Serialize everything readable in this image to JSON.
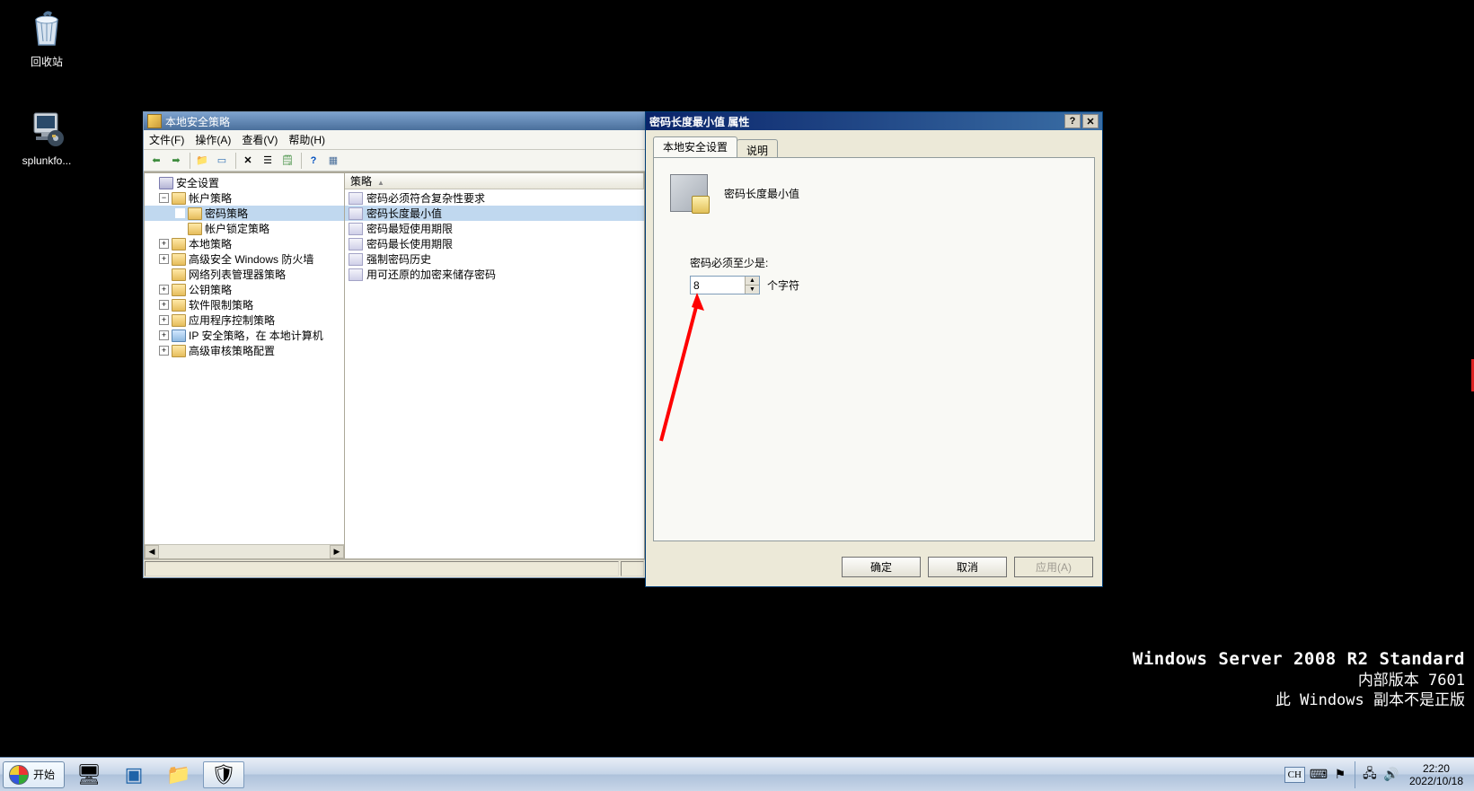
{
  "desktop": {
    "recycle_bin": "回收站",
    "splunk": "splunkfo..."
  },
  "mmc": {
    "title": "本地安全策略",
    "menu": {
      "file": "文件(F)",
      "action": "操作(A)",
      "view": "查看(V)",
      "help": "帮助(H)"
    },
    "tree": {
      "root": "安全设置",
      "account_policies": "帐户策略",
      "password_policy": "密码策略",
      "lockout_policy": "帐户锁定策略",
      "local_policies": "本地策略",
      "wfas": "高级安全 Windows 防火墙",
      "nlm": "网络列表管理器策略",
      "pubkey": "公钥策略",
      "srp": "软件限制策略",
      "appctrl": "应用程序控制策略",
      "ipsec": "IP 安全策略，在 本地计算机",
      "adv_audit": "高级审核策略配置"
    },
    "list": {
      "header_policy": "策略",
      "items": [
        "密码必须符合复杂性要求",
        "密码长度最小值",
        "密码最短使用期限",
        "密码最长使用期限",
        "强制密码历史",
        "用可还原的加密来储存密码"
      ]
    }
  },
  "dialog": {
    "title": "密码长度最小值 属性",
    "tab_local": "本地安全设置",
    "tab_explain": "说明",
    "policy_name": "密码长度最小值",
    "field_label": "密码必须至少是:",
    "value": "8",
    "unit": "个字符",
    "ok": "确定",
    "cancel": "取消",
    "apply": "应用(A)"
  },
  "watermark": {
    "l1": "Windows Server 2008 R2 Standard",
    "l2": "内部版本 7601",
    "l3": "此 Windows 副本不是正版"
  },
  "taskbar": {
    "start": "开始",
    "lang": "CH",
    "time": "22:20",
    "date": "2022/10/18"
  }
}
